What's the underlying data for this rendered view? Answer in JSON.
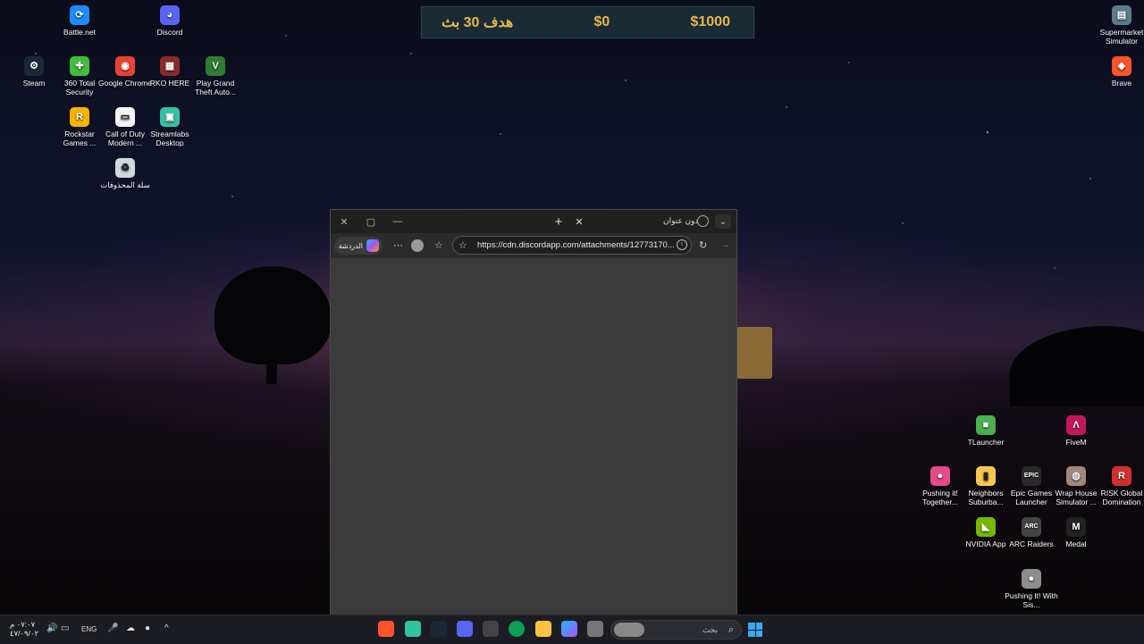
{
  "hud": {
    "money_left": "$1000",
    "money_mid": "$0",
    "goal": "هدف 30 بث"
  },
  "desktop_icons": [
    {
      "label": "Battle.net",
      "color": "#1a8cff",
      "glyph": "⟳"
    },
    {
      "label": "Discord",
      "color": "#5865f2",
      "glyph": "◕"
    },
    {
      "label": "Steam",
      "color": "#1b2838",
      "glyph": "⚙"
    },
    {
      "label": "360 Total Security",
      "color": "#3fbf3f",
      "glyph": "✚"
    },
    {
      "label": "Google Chrome",
      "color": "#ea4335",
      "glyph": "◉"
    },
    {
      "label": "RKO HERE",
      "color": "#8a2a2a",
      "glyph": "▦"
    },
    {
      "label": "Play Grand Theft Auto...",
      "color": "#2e7d32",
      "glyph": "V"
    },
    {
      "label": "Rockstar Games ...",
      "color": "#f4b400",
      "glyph": "R"
    },
    {
      "label": "Call of Duty Modern ...",
      "color": "#f5f5f5",
      "glyph": "▭"
    },
    {
      "label": "Streamlabs Desktop",
      "color": "#31c3a2",
      "glyph": "▣"
    },
    {
      "label": "سلة المحذوفات",
      "color": "#cfd8dc",
      "glyph": "♻"
    },
    {
      "label": "Supermarket Simulator",
      "color": "#5b7b8a",
      "glyph": "▤"
    },
    {
      "label": "Brave",
      "color": "#fb542b",
      "glyph": "◆"
    },
    {
      "label": "TLauncher",
      "color": "#4caf50",
      "glyph": "■"
    },
    {
      "label": "FiveM",
      "color": "#c2185b",
      "glyph": "Λ"
    },
    {
      "label": "Pushing it! Together...",
      "color": "#e64a8a",
      "glyph": "●"
    },
    {
      "label": "Neighbors Suburba...",
      "color": "#f9c74f",
      "glyph": "▮"
    },
    {
      "label": "Epic Games Launcher",
      "color": "#2a2a2a",
      "glyph": "EPIC"
    },
    {
      "label": "Wrap House Simulator ...",
      "color": "#a1887f",
      "glyph": "◍"
    },
    {
      "label": "RISK Global Domination",
      "color": "#d32f2f",
      "glyph": "R"
    },
    {
      "label": "NVIDIA App",
      "color": "#76b900",
      "glyph": "◣"
    },
    {
      "label": "ARC Raiders",
      "color": "#444",
      "glyph": "ARC"
    },
    {
      "label": "Medal",
      "color": "#222",
      "glyph": "M"
    },
    {
      "label": "Pushing It! With Sis...",
      "color": "#8d8d8d",
      "glyph": "●"
    }
  ],
  "browser": {
    "tab_title": "دون عنوان",
    "chat_label": "الدردشة",
    "url": "https://cdn.discordapp.com/attachments/12773170..."
  },
  "taskbar": {
    "time": "٠٧:٠٧ م",
    "date": "٤٧/٠٩/٠٢",
    "lang": "ENG",
    "search_placeholder": "بحث"
  }
}
